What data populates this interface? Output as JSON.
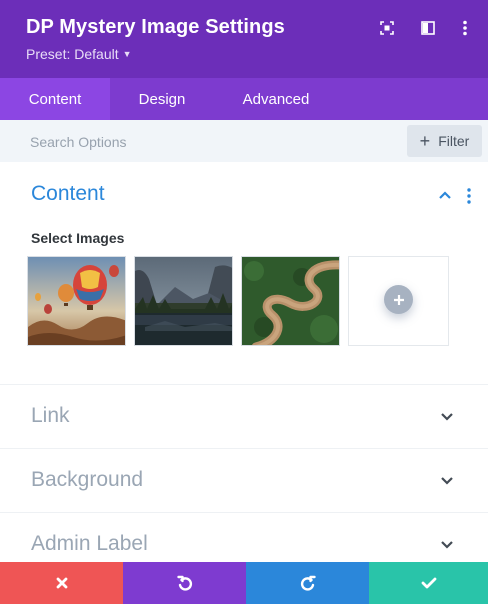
{
  "header": {
    "title": "DP Mystery Image Settings",
    "preset_label": "Preset: Default",
    "icons": [
      "expand-icon",
      "sidebar-toggle-icon",
      "more-vertical-icon"
    ],
    "background": "#6c2eb9"
  },
  "tabs": [
    {
      "label": "Content",
      "active": true
    },
    {
      "label": "Design",
      "active": false
    },
    {
      "label": "Advanced",
      "active": false
    }
  ],
  "search": {
    "placeholder": "Search Options",
    "filter_label": "Filter"
  },
  "content_section": {
    "title": "Content",
    "select_images_label": "Select Images",
    "images": [
      "hot-air-balloons",
      "mountain-valley-lake",
      "winding-river-aerial"
    ],
    "add_button_icon": "plus-icon"
  },
  "collapsed_sections": [
    {
      "title": "Link"
    },
    {
      "title": "Background"
    },
    {
      "title": "Admin Label"
    }
  ],
  "footer": {
    "buttons": [
      {
        "name": "cancel",
        "icon": "close-icon",
        "color": "#ef5555"
      },
      {
        "name": "undo",
        "icon": "undo-icon",
        "color": "#7e3bd0"
      },
      {
        "name": "redo",
        "icon": "redo-icon",
        "color": "#2b87da"
      },
      {
        "name": "save",
        "icon": "check-icon",
        "color": "#29c4a9"
      }
    ]
  },
  "colors": {
    "accent_blue": "#2b87da",
    "muted_title": "#9aa6b4"
  }
}
